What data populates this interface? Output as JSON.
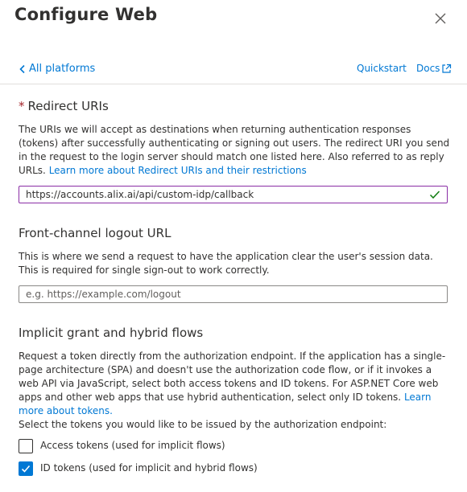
{
  "panel": {
    "title": "Configure Web"
  },
  "nav": {
    "back_label": "All platforms",
    "quickstart_label": "Quickstart",
    "docs_label": "Docs"
  },
  "redirect": {
    "required_mark": "*",
    "heading": "Redirect URIs",
    "description": "The URIs we will accept as destinations when returning authentication responses (tokens) after successfully authenticating or signing out users. The redirect URI you send in the request to the login server should match one listed here. Also referred to as reply URLs.",
    "learn_more": "Learn more about Redirect URIs and their restrictions",
    "uri_value": "https://accounts.alix.ai/api/custom-idp/callback"
  },
  "logout": {
    "heading": "Front-channel logout URL",
    "description": "This is where we send a request to have the application clear the user's session data. This is required for single sign-out to work correctly.",
    "placeholder": "e.g. https://example.com/logout"
  },
  "implicit": {
    "heading": "Implicit grant and hybrid flows",
    "description": "Request a token directly from the authorization endpoint. If the application has a single-page architecture (SPA) and doesn't use the authorization code flow, or if it invokes a web API via JavaScript, select both access tokens and ID tokens. For ASP.NET Core web apps and other web apps that use hybrid authentication, select only ID tokens.",
    "learn_more": "Learn more about tokens.",
    "select_prompt": "Select the tokens you would like to be issued by the authorization endpoint:",
    "options": [
      {
        "label": "Access tokens (used for implicit flows)",
        "checked": false
      },
      {
        "label": "ID tokens (used for implicit and hybrid flows)",
        "checked": true
      }
    ]
  },
  "colors": {
    "accent": "#0078d4",
    "valid": "#107c10",
    "required": "#a4262c",
    "focus_border": "#8a2da5"
  }
}
